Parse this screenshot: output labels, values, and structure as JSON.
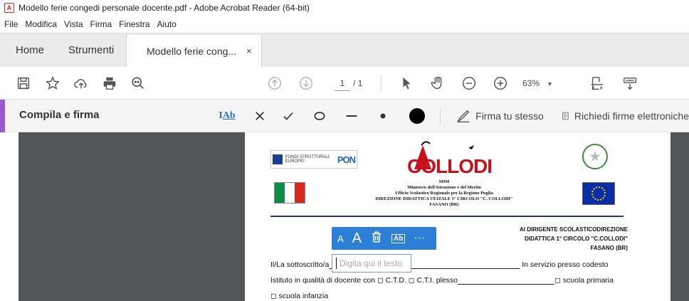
{
  "window": {
    "title": "Modello ferie congedi personale docente.pdf - Adobe Acrobat Reader (64-bit)",
    "app_icon": "acrobat-icon"
  },
  "menu": [
    "File",
    "Modifica",
    "Vista",
    "Firma",
    "Finestra",
    "Aiuto"
  ],
  "tabs": {
    "home": "Home",
    "tools": "Strumenti",
    "document": "Modello ferie cong...",
    "close": "×"
  },
  "toolbar": {
    "page_current": "1",
    "page_total": "/ 1",
    "zoom": "63%"
  },
  "fill_sign": {
    "title": "Compila e firma",
    "text_tool": "Ab",
    "sign_yourself": "Firma tu stesso",
    "request_signatures": "Richiedi firme elettroniche",
    "accent_color": "#9b59d0"
  },
  "document": {
    "pon_label": "FONDI STRUTTURALI EUROPEI",
    "pon_mark": "PON",
    "school_logo": "COLLODI",
    "header": [
      "MIM",
      "Ministero dell'Istruzione e del Merito",
      "Ufficio Scolastico Regionale per la Regione Puglia",
      "DIREZIONE DIDATTICA STATALE 1° CIRCOLO \"C. COLLODI\"",
      "FASANO (BR)"
    ],
    "recipient": [
      "Al DIRIGENTE SCOLASTICODIREZIONE",
      "DIDATTICA 1° CIRCOLO \"C.COLLODI\"",
      "FASANO (BR)"
    ],
    "line1_start": "Il/La sottoscritto/a",
    "line1_end": "In servizio presso codesto",
    "line2_start": "Istituto in qualità di docente con ◻ C.T.D.  ◻ C.T.I. plesso",
    "line2_end": "◻ scuola primaria",
    "line3": "◻ scuola infanzia"
  },
  "text_field": {
    "placeholder": "Digita qui il testo",
    "value": ""
  },
  "float_toolbar": {
    "small_a": "A",
    "large_a": "A",
    "ab": "Ab",
    "more": "···"
  }
}
